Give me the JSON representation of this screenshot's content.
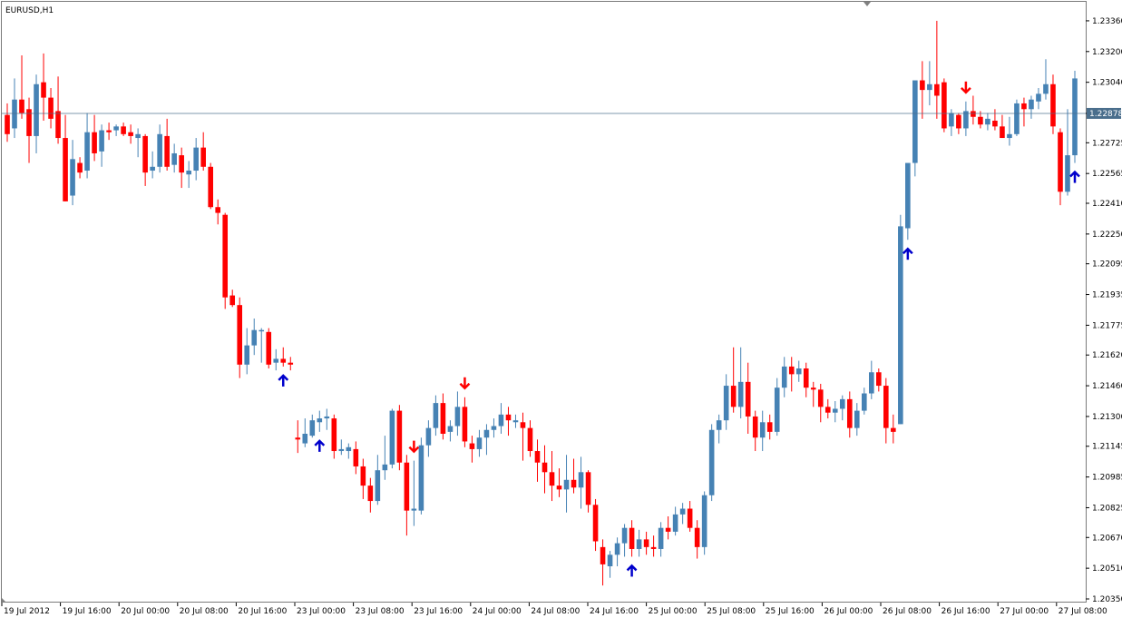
{
  "chart": {
    "symbol_label": "EURUSD,H1",
    "current_price": "1.22878",
    "up_color": "#4682b4",
    "down_color": "#ff0000",
    "buy_arrow_color": "#0000cc",
    "sell_arrow_color": "#ff0000",
    "price_line_color": "#4a6e8c"
  },
  "chart_data": {
    "type": "candlestick",
    "instrument": "EURUSD",
    "timeframe": "H1",
    "ylim": [
      1.2035,
      1.2344
    ],
    "yticks": [
      "1.23360",
      "1.23200",
      "1.23040",
      "1.22878",
      "1.22725",
      "1.22565",
      "1.22410",
      "1.22250",
      "1.22095",
      "1.21935",
      "1.21775",
      "1.21620",
      "1.21460",
      "1.21300",
      "1.21145",
      "1.20985",
      "1.20825",
      "1.20670",
      "1.20510",
      "1.20350"
    ],
    "xticks": [
      "19 Jul 2012",
      "19 Jul 16:00",
      "20 Jul 00:00",
      "20 Jul 08:00",
      "20 Jul 16:00",
      "23 Jul 00:00",
      "23 Jul 08:00",
      "23 Jul 16:00",
      "24 Jul 00:00",
      "24 Jul 08:00",
      "24 Jul 16:00",
      "25 Jul 00:00",
      "25 Jul 08:00",
      "25 Jul 16:00",
      "26 Jul 00:00",
      "26 Jul 08:00",
      "26 Jul 16:00",
      "27 Jul 00:00",
      "27 Jul 08:00"
    ],
    "candles": [
      {
        "o": 1.2287,
        "h": 1.2293,
        "l": 1.2273,
        "c": 1.2277
      },
      {
        "o": 1.228,
        "h": 1.2306,
        "l": 1.2275,
        "c": 1.2295
      },
      {
        "o": 1.2295,
        "h": 1.2318,
        "l": 1.2285,
        "c": 1.2288
      },
      {
        "o": 1.229,
        "h": 1.2296,
        "l": 1.2262,
        "c": 1.2276
      },
      {
        "o": 1.2276,
        "h": 1.2308,
        "l": 1.2267,
        "c": 1.2303
      },
      {
        "o": 1.2304,
        "h": 1.2319,
        "l": 1.2284,
        "c": 1.2296
      },
      {
        "o": 1.2296,
        "h": 1.2301,
        "l": 1.228,
        "c": 1.2285
      },
      {
        "o": 1.2289,
        "h": 1.2307,
        "l": 1.2272,
        "c": 1.2275
      },
      {
        "o": 1.2275,
        "h": 1.2287,
        "l": 1.2242,
        "c": 1.2242
      },
      {
        "o": 1.2245,
        "h": 1.2274,
        "l": 1.224,
        "c": 1.2264
      },
      {
        "o": 1.2262,
        "h": 1.2265,
        "l": 1.2254,
        "c": 1.2257
      },
      {
        "o": 1.2258,
        "h": 1.2288,
        "l": 1.2254,
        "c": 1.2278
      },
      {
        "o": 1.2278,
        "h": 1.2287,
        "l": 1.2263,
        "c": 1.2267
      },
      {
        "o": 1.2268,
        "h": 1.2282,
        "l": 1.226,
        "c": 1.2279
      },
      {
        "o": 1.2279,
        "h": 1.2283,
        "l": 1.2274,
        "c": 1.2278
      },
      {
        "o": 1.2279,
        "h": 1.2282,
        "l": 1.2276,
        "c": 1.2281
      },
      {
        "o": 1.2281,
        "h": 1.2283,
        "l": 1.2276,
        "c": 1.2277
      },
      {
        "o": 1.2278,
        "h": 1.2282,
        "l": 1.2272,
        "c": 1.2276
      },
      {
        "o": 1.2275,
        "h": 1.228,
        "l": 1.2265,
        "c": 1.2277
      },
      {
        "o": 1.2276,
        "h": 1.2277,
        "l": 1.225,
        "c": 1.2257
      },
      {
        "o": 1.2258,
        "h": 1.2268,
        "l": 1.2254,
        "c": 1.226
      },
      {
        "o": 1.226,
        "h": 1.2282,
        "l": 1.2257,
        "c": 1.2277
      },
      {
        "o": 1.2276,
        "h": 1.2285,
        "l": 1.2258,
        "c": 1.226
      },
      {
        "o": 1.2261,
        "h": 1.2272,
        "l": 1.2257,
        "c": 1.2267
      },
      {
        "o": 1.2266,
        "h": 1.227,
        "l": 1.2249,
        "c": 1.2257
      },
      {
        "o": 1.2256,
        "h": 1.2263,
        "l": 1.2249,
        "c": 1.2258
      },
      {
        "o": 1.2258,
        "h": 1.2275,
        "l": 1.2253,
        "c": 1.227
      },
      {
        "o": 1.227,
        "h": 1.2278,
        "l": 1.2258,
        "c": 1.226
      },
      {
        "o": 1.226,
        "h": 1.2262,
        "l": 1.2238,
        "c": 1.2239
      },
      {
        "o": 1.2239,
        "h": 1.2243,
        "l": 1.223,
        "c": 1.2236
      },
      {
        "o": 1.2235,
        "h": 1.2236,
        "l": 1.2186,
        "c": 1.2192
      },
      {
        "o": 1.2193,
        "h": 1.2196,
        "l": 1.2187,
        "c": 1.2188
      },
      {
        "o": 1.2188,
        "h": 1.2192,
        "l": 1.215,
        "c": 1.2157
      },
      {
        "o": 1.2157,
        "h": 1.2176,
        "l": 1.2152,
        "c": 1.2167
      },
      {
        "o": 1.2167,
        "h": 1.2181,
        "l": 1.2162,
        "c": 1.2175
      },
      {
        "o": 1.2175,
        "h": 1.2176,
        "l": 1.2158,
        "c": 1.2175
      },
      {
        "o": 1.2174,
        "h": 1.2176,
        "l": 1.2155,
        "c": 1.2157
      },
      {
        "o": 1.2158,
        "h": 1.2165,
        "l": 1.2154,
        "c": 1.216
      },
      {
        "o": 1.216,
        "h": 1.2166,
        "l": 1.2156,
        "c": 1.2158
      },
      {
        "o": 1.2158,
        "h": 1.2161,
        "l": 1.2154,
        "c": 1.2157
      },
      {
        "o": 1.2119,
        "h": 1.2128,
        "l": 1.2111,
        "c": 1.2118
      },
      {
        "o": 1.2116,
        "h": 1.2129,
        "l": 1.2114,
        "c": 1.2121
      },
      {
        "o": 1.212,
        "h": 1.2131,
        "l": 1.2119,
        "c": 1.2128
      },
      {
        "o": 1.2127,
        "h": 1.2133,
        "l": 1.2122,
        "c": 1.2129
      },
      {
        "o": 1.2129,
        "h": 1.2134,
        "l": 1.2123,
        "c": 1.213
      },
      {
        "o": 1.2129,
        "h": 1.2131,
        "l": 1.2108,
        "c": 1.2112
      },
      {
        "o": 1.2112,
        "h": 1.2118,
        "l": 1.211,
        "c": 1.2113
      },
      {
        "o": 1.2112,
        "h": 1.2116,
        "l": 1.2108,
        "c": 1.2114
      },
      {
        "o": 1.2113,
        "h": 1.2117,
        "l": 1.21,
        "c": 1.2104
      },
      {
        "o": 1.2104,
        "h": 1.2108,
        "l": 1.2087,
        "c": 1.2094
      },
      {
        "o": 1.2094,
        "h": 1.2098,
        "l": 1.208,
        "c": 1.2086
      },
      {
        "o": 1.2086,
        "h": 1.211,
        "l": 1.2084,
        "c": 1.2102
      },
      {
        "o": 1.2102,
        "h": 1.212,
        "l": 1.2097,
        "c": 1.2105
      },
      {
        "o": 1.2105,
        "h": 1.2134,
        "l": 1.2103,
        "c": 1.2133
      },
      {
        "o": 1.2133,
        "h": 1.2136,
        "l": 1.2102,
        "c": 1.2106
      },
      {
        "o": 1.2106,
        "h": 1.211,
        "l": 1.2068,
        "c": 1.2081
      },
      {
        "o": 1.2081,
        "h": 1.2107,
        "l": 1.2073,
        "c": 1.2082
      },
      {
        "o": 1.2081,
        "h": 1.2119,
        "l": 1.2079,
        "c": 1.2115
      },
      {
        "o": 1.2115,
        "h": 1.2128,
        "l": 1.2109,
        "c": 1.2124
      },
      {
        "o": 1.2124,
        "h": 1.2141,
        "l": 1.212,
        "c": 1.2137
      },
      {
        "o": 1.2137,
        "h": 1.2142,
        "l": 1.2118,
        "c": 1.2121
      },
      {
        "o": 1.2122,
        "h": 1.2128,
        "l": 1.2117,
        "c": 1.2125
      },
      {
        "o": 1.2125,
        "h": 1.2143,
        "l": 1.212,
        "c": 1.2135
      },
      {
        "o": 1.2135,
        "h": 1.214,
        "l": 1.2114,
        "c": 1.2117
      },
      {
        "o": 1.2116,
        "h": 1.212,
        "l": 1.2106,
        "c": 1.2113
      },
      {
        "o": 1.2113,
        "h": 1.2123,
        "l": 1.2109,
        "c": 1.2119
      },
      {
        "o": 1.2119,
        "h": 1.2126,
        "l": 1.211,
        "c": 1.2123
      },
      {
        "o": 1.2123,
        "h": 1.2129,
        "l": 1.2119,
        "c": 1.2125
      },
      {
        "o": 1.2125,
        "h": 1.2137,
        "l": 1.2121,
        "c": 1.2131
      },
      {
        "o": 1.2131,
        "h": 1.2135,
        "l": 1.212,
        "c": 1.2128
      },
      {
        "o": 1.2127,
        "h": 1.2131,
        "l": 1.2124,
        "c": 1.2128
      },
      {
        "o": 1.2127,
        "h": 1.2132,
        "l": 1.2107,
        "c": 1.2124
      },
      {
        "o": 1.2124,
        "h": 1.2128,
        "l": 1.2109,
        "c": 1.2112
      },
      {
        "o": 1.2112,
        "h": 1.2118,
        "l": 1.2096,
        "c": 1.2106
      },
      {
        "o": 1.2106,
        "h": 1.2115,
        "l": 1.209,
        "c": 1.2101
      },
      {
        "o": 1.2101,
        "h": 1.2112,
        "l": 1.2086,
        "c": 1.2094
      },
      {
        "o": 1.2094,
        "h": 1.2103,
        "l": 1.2088,
        "c": 1.2092
      },
      {
        "o": 1.2092,
        "h": 1.211,
        "l": 1.208,
        "c": 1.2097
      },
      {
        "o": 1.2097,
        "h": 1.2108,
        "l": 1.209,
        "c": 1.2093
      },
      {
        "o": 1.2093,
        "h": 1.2109,
        "l": 1.2082,
        "c": 1.2101
      },
      {
        "o": 1.2101,
        "h": 1.2102,
        "l": 1.208,
        "c": 1.2084
      },
      {
        "o": 1.2084,
        "h": 1.2087,
        "l": 1.206,
        "c": 1.2065
      },
      {
        "o": 1.2062,
        "h": 1.2066,
        "l": 1.2042,
        "c": 1.2053
      },
      {
        "o": 1.2052,
        "h": 1.206,
        "l": 1.2046,
        "c": 1.2058
      },
      {
        "o": 1.2058,
        "h": 1.2067,
        "l": 1.2052,
        "c": 1.2064
      },
      {
        "o": 1.2064,
        "h": 1.2074,
        "l": 1.2057,
        "c": 1.2072
      },
      {
        "o": 1.2072,
        "h": 1.2076,
        "l": 1.2057,
        "c": 1.2061
      },
      {
        "o": 1.2061,
        "h": 1.2071,
        "l": 1.2057,
        "c": 1.2066
      },
      {
        "o": 1.2066,
        "h": 1.207,
        "l": 1.2058,
        "c": 1.2062
      },
      {
        "o": 1.2062,
        "h": 1.2068,
        "l": 1.2057,
        "c": 1.2061
      },
      {
        "o": 1.2061,
        "h": 1.2075,
        "l": 1.2057,
        "c": 1.2072
      },
      {
        "o": 1.2072,
        "h": 1.2078,
        "l": 1.2066,
        "c": 1.207
      },
      {
        "o": 1.207,
        "h": 1.2083,
        "l": 1.2068,
        "c": 1.2079
      },
      {
        "o": 1.2079,
        "h": 1.2085,
        "l": 1.2074,
        "c": 1.2082
      },
      {
        "o": 1.2082,
        "h": 1.2086,
        "l": 1.207,
        "c": 1.2072
      },
      {
        "o": 1.2072,
        "h": 1.2076,
        "l": 1.2056,
        "c": 1.2062
      },
      {
        "o": 1.2062,
        "h": 1.2091,
        "l": 1.2058,
        "c": 1.2089
      },
      {
        "o": 1.2089,
        "h": 1.2126,
        "l": 1.2086,
        "c": 1.2123
      },
      {
        "o": 1.2123,
        "h": 1.2131,
        "l": 1.2116,
        "c": 1.2128
      },
      {
        "o": 1.2128,
        "h": 1.2152,
        "l": 1.2123,
        "c": 1.2146
      },
      {
        "o": 1.2146,
        "h": 1.2166,
        "l": 1.2132,
        "c": 1.2135
      },
      {
        "o": 1.2135,
        "h": 1.2166,
        "l": 1.2129,
        "c": 1.2148
      },
      {
        "o": 1.2148,
        "h": 1.2158,
        "l": 1.2121,
        "c": 1.213
      },
      {
        "o": 1.213,
        "h": 1.2133,
        "l": 1.2112,
        "c": 1.2119
      },
      {
        "o": 1.2119,
        "h": 1.2133,
        "l": 1.2112,
        "c": 1.2127
      },
      {
        "o": 1.2127,
        "h": 1.2131,
        "l": 1.2118,
        "c": 1.2122
      },
      {
        "o": 1.2122,
        "h": 1.215,
        "l": 1.212,
        "c": 1.2145
      },
      {
        "o": 1.2145,
        "h": 1.2161,
        "l": 1.214,
        "c": 1.2156
      },
      {
        "o": 1.2156,
        "h": 1.2161,
        "l": 1.2143,
        "c": 1.2152
      },
      {
        "o": 1.2152,
        "h": 1.2159,
        "l": 1.2148,
        "c": 1.2155
      },
      {
        "o": 1.2155,
        "h": 1.2158,
        "l": 1.214,
        "c": 1.2145
      },
      {
        "o": 1.2145,
        "h": 1.2148,
        "l": 1.2135,
        "c": 1.2144
      },
      {
        "o": 1.2144,
        "h": 1.2147,
        "l": 1.2127,
        "c": 1.2135
      },
      {
        "o": 1.2135,
        "h": 1.2139,
        "l": 1.2129,
        "c": 1.2132
      },
      {
        "o": 1.2132,
        "h": 1.2138,
        "l": 1.2127,
        "c": 1.2134
      },
      {
        "o": 1.2134,
        "h": 1.2141,
        "l": 1.2128,
        "c": 1.2139
      },
      {
        "o": 1.2139,
        "h": 1.2143,
        "l": 1.2119,
        "c": 1.2124
      },
      {
        "o": 1.2124,
        "h": 1.2137,
        "l": 1.212,
        "c": 1.2133
      },
      {
        "o": 1.2133,
        "h": 1.2145,
        "l": 1.2131,
        "c": 1.2142
      },
      {
        "o": 1.2142,
        "h": 1.2159,
        "l": 1.2139,
        "c": 1.2153
      },
      {
        "o": 1.2153,
        "h": 1.2155,
        "l": 1.2143,
        "c": 1.2146
      },
      {
        "o": 1.2146,
        "h": 1.215,
        "l": 1.2116,
        "c": 1.2124
      },
      {
        "o": 1.2124,
        "h": 1.2131,
        "l": 1.2116,
        "c": 1.2122
      },
      {
        "o": 1.2126,
        "h": 1.2235,
        "l": 1.2126,
        "c": 1.2229
      },
      {
        "o": 1.2228,
        "h": 1.2261,
        "l": 1.2222,
        "c": 1.2262
      },
      {
        "o": 1.2262,
        "h": 1.2302,
        "l": 1.2255,
        "c": 1.2305
      },
      {
        "o": 1.2305,
        "h": 1.2315,
        "l": 1.2285,
        "c": 1.23
      },
      {
        "o": 1.23,
        "h": 1.2315,
        "l": 1.2292,
        "c": 1.2303
      },
      {
        "o": 1.2303,
        "h": 1.2336,
        "l": 1.2285,
        "c": 1.2297
      },
      {
        "o": 1.2304,
        "h": 1.2306,
        "l": 1.2278,
        "c": 1.228
      },
      {
        "o": 1.2281,
        "h": 1.229,
        "l": 1.2276,
        "c": 1.2288
      },
      {
        "o": 1.2287,
        "h": 1.2288,
        "l": 1.2277,
        "c": 1.228
      },
      {
        "o": 1.228,
        "h": 1.2294,
        "l": 1.2276,
        "c": 1.2289
      },
      {
        "o": 1.2289,
        "h": 1.2297,
        "l": 1.2282,
        "c": 1.2286
      },
      {
        "o": 1.2286,
        "h": 1.2289,
        "l": 1.228,
        "c": 1.2282
      },
      {
        "o": 1.2282,
        "h": 1.2288,
        "l": 1.2279,
        "c": 1.2285
      },
      {
        "o": 1.2284,
        "h": 1.229,
        "l": 1.2279,
        "c": 1.2281
      },
      {
        "o": 1.2281,
        "h": 1.2287,
        "l": 1.2275,
        "c": 1.2275
      },
      {
        "o": 1.2275,
        "h": 1.2286,
        "l": 1.2271,
        "c": 1.2277
      },
      {
        "o": 1.2277,
        "h": 1.2295,
        "l": 1.2276,
        "c": 1.2293
      },
      {
        "o": 1.2293,
        "h": 1.2296,
        "l": 1.2281,
        "c": 1.229
      },
      {
        "o": 1.229,
        "h": 1.2297,
        "l": 1.2285,
        "c": 1.2295
      },
      {
        "o": 1.2294,
        "h": 1.2301,
        "l": 1.229,
        "c": 1.2298
      },
      {
        "o": 1.2298,
        "h": 1.2316,
        "l": 1.2295,
        "c": 1.2303
      },
      {
        "o": 1.2303,
        "h": 1.2308,
        "l": 1.2277,
        "c": 1.2281
      },
      {
        "o": 1.2278,
        "h": 1.228,
        "l": 1.224,
        "c": 1.2247
      },
      {
        "o": 1.2247,
        "h": 1.229,
        "l": 1.2245,
        "c": 1.2266
      },
      {
        "o": 1.2266,
        "h": 1.231,
        "l": 1.2262,
        "c": 1.2306
      }
    ],
    "buy_signals": [
      38,
      43,
      86,
      124,
      147
    ],
    "sell_signals": [
      56,
      63,
      132
    ]
  }
}
